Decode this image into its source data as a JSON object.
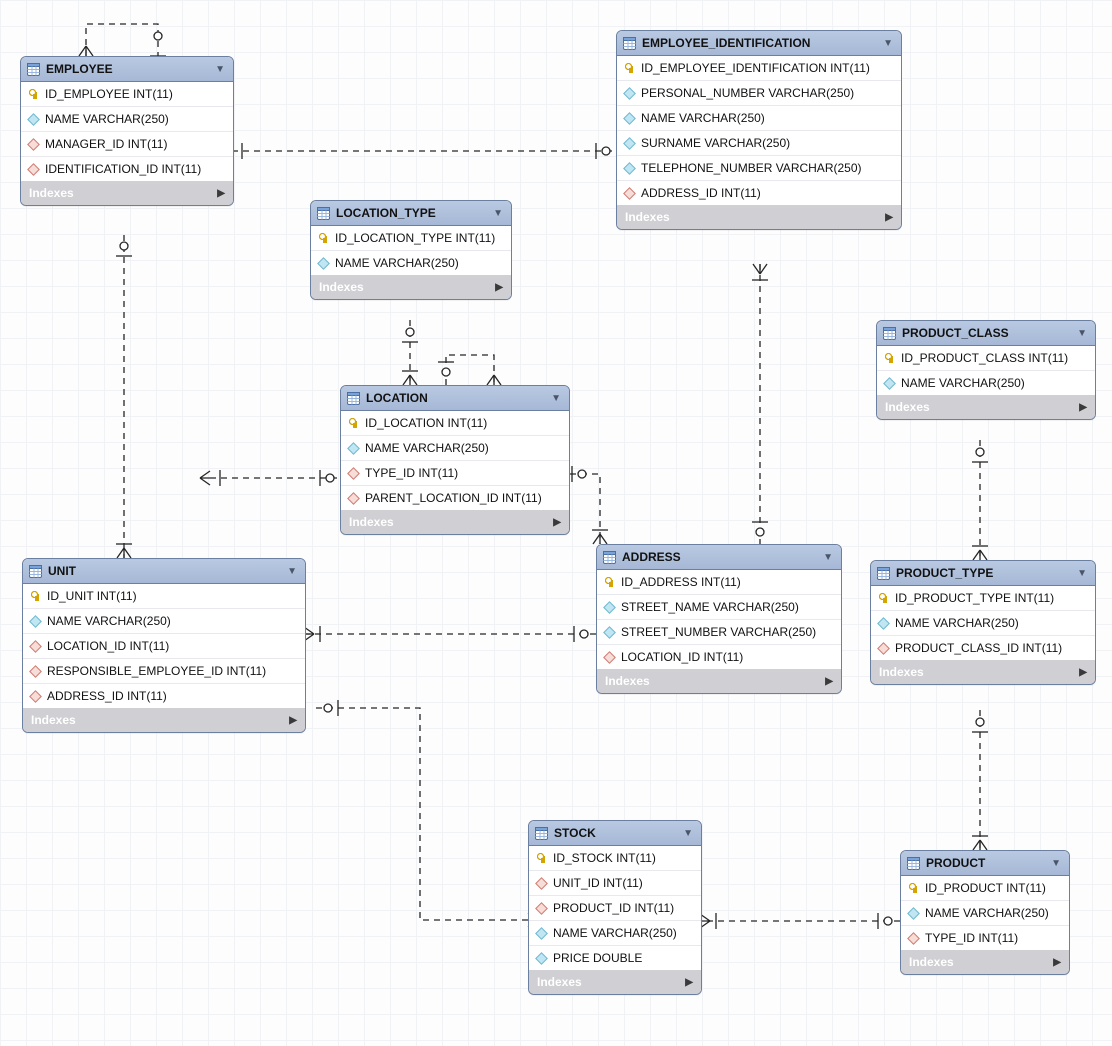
{
  "indexes_label": "Indexes",
  "tables": {
    "employee": {
      "title": "EMPLOYEE",
      "cols": [
        {
          "t": "ID_EMPLOYEE INT(11)",
          "k": "pk"
        },
        {
          "t": "NAME VARCHAR(250)",
          "k": "col"
        },
        {
          "t": "MANAGER_ID INT(11)",
          "k": "fk"
        },
        {
          "t": "IDENTIFICATION_ID INT(11)",
          "k": "fk"
        }
      ]
    },
    "employee_identification": {
      "title": "EMPLOYEE_IDENTIFICATION",
      "cols": [
        {
          "t": "ID_EMPLOYEE_IDENTIFICATION INT(11)",
          "k": "pk"
        },
        {
          "t": "PERSONAL_NUMBER VARCHAR(250)",
          "k": "col"
        },
        {
          "t": "NAME VARCHAR(250)",
          "k": "col"
        },
        {
          "t": "SURNAME VARCHAR(250)",
          "k": "col"
        },
        {
          "t": "TELEPHONE_NUMBER VARCHAR(250)",
          "k": "col"
        },
        {
          "t": "ADDRESS_ID INT(11)",
          "k": "fk"
        }
      ]
    },
    "location_type": {
      "title": "LOCATION_TYPE",
      "cols": [
        {
          "t": "ID_LOCATION_TYPE INT(11)",
          "k": "pk"
        },
        {
          "t": "NAME VARCHAR(250)",
          "k": "col"
        }
      ]
    },
    "location": {
      "title": "LOCATION",
      "cols": [
        {
          "t": "ID_LOCATION INT(11)",
          "k": "pk"
        },
        {
          "t": "NAME VARCHAR(250)",
          "k": "col"
        },
        {
          "t": "TYPE_ID INT(11)",
          "k": "fk"
        },
        {
          "t": "PARENT_LOCATION_ID INT(11)",
          "k": "fk"
        }
      ]
    },
    "unit": {
      "title": "UNIT",
      "cols": [
        {
          "t": "ID_UNIT INT(11)",
          "k": "pk"
        },
        {
          "t": "NAME VARCHAR(250)",
          "k": "col"
        },
        {
          "t": "LOCATION_ID INT(11)",
          "k": "fk"
        },
        {
          "t": "RESPONSIBLE_EMPLOYEE_ID INT(11)",
          "k": "fk"
        },
        {
          "t": "ADDRESS_ID INT(11)",
          "k": "fk"
        }
      ]
    },
    "address": {
      "title": "ADDRESS",
      "cols": [
        {
          "t": "ID_ADDRESS INT(11)",
          "k": "pk"
        },
        {
          "t": "STREET_NAME VARCHAR(250)",
          "k": "col"
        },
        {
          "t": "STREET_NUMBER VARCHAR(250)",
          "k": "col"
        },
        {
          "t": "LOCATION_ID INT(11)",
          "k": "fk"
        }
      ]
    },
    "product_class": {
      "title": "PRODUCT_CLASS",
      "cols": [
        {
          "t": "ID_PRODUCT_CLASS INT(11)",
          "k": "pk"
        },
        {
          "t": "NAME VARCHAR(250)",
          "k": "col"
        }
      ]
    },
    "product_type": {
      "title": "PRODUCT_TYPE",
      "cols": [
        {
          "t": "ID_PRODUCT_TYPE INT(11)",
          "k": "pk"
        },
        {
          "t": "NAME VARCHAR(250)",
          "k": "col"
        },
        {
          "t": "PRODUCT_CLASS_ID INT(11)",
          "k": "fk"
        }
      ]
    },
    "product": {
      "title": "PRODUCT",
      "cols": [
        {
          "t": "ID_PRODUCT INT(11)",
          "k": "pk"
        },
        {
          "t": "NAME VARCHAR(250)",
          "k": "col"
        },
        {
          "t": "TYPE_ID INT(11)",
          "k": "fk"
        }
      ]
    },
    "stock": {
      "title": "STOCK",
      "cols": [
        {
          "t": "ID_STOCK INT(11)",
          "k": "pk"
        },
        {
          "t": "UNIT_ID INT(11)",
          "k": "fk"
        },
        {
          "t": "PRODUCT_ID INT(11)",
          "k": "fk"
        },
        {
          "t": "NAME VARCHAR(250)",
          "k": "col"
        },
        {
          "t": "PRICE DOUBLE",
          "k": "col"
        }
      ]
    }
  }
}
